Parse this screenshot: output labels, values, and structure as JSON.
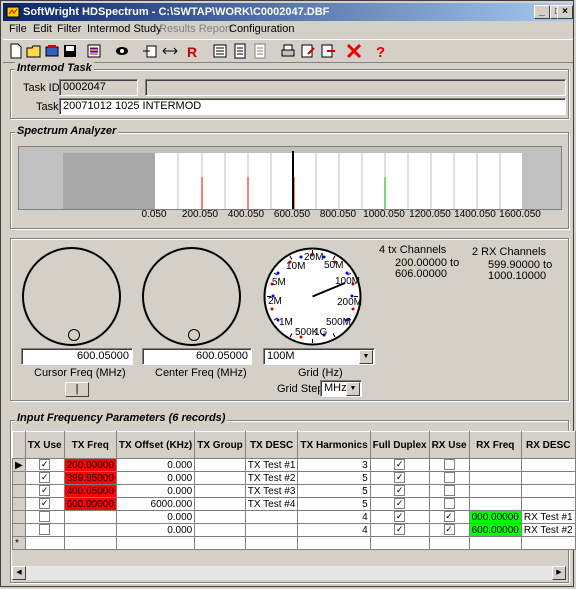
{
  "window": {
    "title": "SoftWright HDSpectrum - C:\\SWTAP\\WORK\\C0002047.DBF",
    "min_icon": "minimize-icon",
    "max_icon": "maximize-icon",
    "close_icon": "close-icon"
  },
  "menu": [
    "File",
    "Edit",
    "Filter",
    "Intermod Study",
    "Results Report",
    "Configuration"
  ],
  "intermod": {
    "title": "Intermod Task",
    "task_id_label": "Task ID:",
    "task_id": "0002047",
    "task_label": "Task",
    "task": "20071012 1025 INTERMOD"
  },
  "spectrum": {
    "title": "Spectrum Analyzer",
    "ticks": [
      "0.050",
      "200.050",
      "400.050",
      "600.050",
      "800.050",
      "1000.050",
      "1200.050",
      "1400.050",
      "1600.050"
    ]
  },
  "controls": {
    "cursor_freq": "600.05000",
    "cursor_label": "Cursor Freq (MHz)",
    "center_freq": "600.05000",
    "center_label": "Center Freq (MHz)",
    "grid_value": "100M",
    "grid_label": "Grid (Hz)",
    "grid_step_label": "Grid Step",
    "grid_step_value": "MHz",
    "dial_labels": [
      "10M",
      "20M",
      "50M",
      "100M",
      "200M",
      "500M",
      "1G",
      "500K",
      "1M",
      "2M",
      "5M"
    ],
    "tx_channels": "4 tx Channels",
    "tx_range_1": "200.00000 to",
    "tx_range_2": "606.00000",
    "rx_channels": "2 RX Channels",
    "rx_range_1": "599.90000 to",
    "rx_range_2": "1000.10000",
    "button_label": "|"
  },
  "grid": {
    "title": "Input Frequency Parameters (6 records)",
    "headers": [
      "TX Use",
      "TX Freq",
      "TX Offset (KHz)",
      "TX Group",
      "TX DESC",
      "TX Harmonics",
      "Full Duplex",
      "RX Use",
      "RX Freq",
      "RX DESC"
    ],
    "rows": [
      {
        "tx_use": true,
        "tx_freq": "200.00000",
        "tx_offset": "0.000",
        "tx_group": "",
        "tx_desc": "TX Test #1",
        "harm": "3",
        "duplex": true,
        "rx_use": false,
        "rx_freq": "",
        "rx_desc": ""
      },
      {
        "tx_use": true,
        "tx_freq": "399.95000",
        "tx_offset": "0.000",
        "tx_group": "",
        "tx_desc": "TX Test #2",
        "harm": "5",
        "duplex": true,
        "rx_use": false,
        "rx_freq": "",
        "rx_desc": ""
      },
      {
        "tx_use": true,
        "tx_freq": "400.05000",
        "tx_offset": "0.000",
        "tx_group": "",
        "tx_desc": "TX Test #3",
        "harm": "5",
        "duplex": true,
        "rx_use": false,
        "rx_freq": "",
        "rx_desc": ""
      },
      {
        "tx_use": true,
        "tx_freq": "600.00000",
        "tx_offset": "6000.000",
        "tx_group": "",
        "tx_desc": "TX Test #4",
        "harm": "5",
        "duplex": true,
        "rx_use": false,
        "rx_freq": "",
        "rx_desc": ""
      },
      {
        "tx_use": false,
        "tx_freq": "",
        "tx_offset": "0.000",
        "tx_group": "",
        "tx_desc": "",
        "harm": "4",
        "duplex": true,
        "rx_use": true,
        "rx_freq": "000.00000",
        "rx_desc": "RX Test #1"
      },
      {
        "tx_use": false,
        "tx_freq": "",
        "tx_offset": "0.000",
        "tx_group": "",
        "tx_desc": "",
        "harm": "4",
        "duplex": true,
        "rx_use": true,
        "rx_freq": "600.00000",
        "rx_desc": "RX Test #2"
      }
    ]
  },
  "colors": {
    "tx_highlight": "#ff0000",
    "rx_highlight": "#00ff00",
    "title_start": "#0a246a",
    "title_end": "#a6caf0"
  }
}
